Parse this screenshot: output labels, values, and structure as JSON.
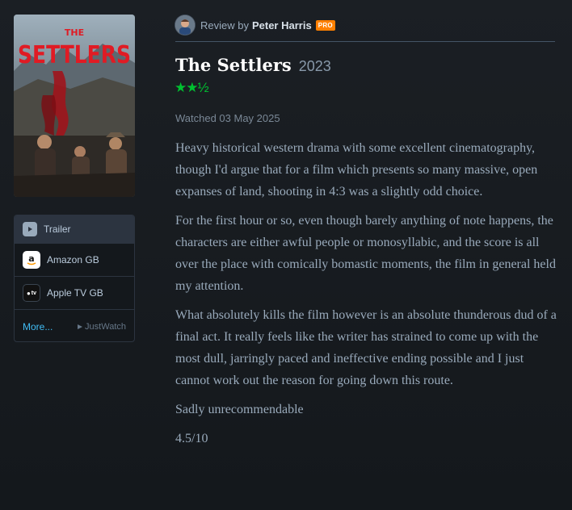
{
  "poster": {
    "title_small": "THE",
    "title_big": "SETTLERS"
  },
  "services": {
    "trailer_label": "Trailer",
    "items": [
      {
        "label": "Amazon GB",
        "icon": "amazon-icon"
      },
      {
        "label": "Apple TV GB",
        "icon": "apple-tv-icon",
        "icon_text": "tv"
      }
    ],
    "more_label": "More...",
    "justwatch_label": "JustWatch"
  },
  "review": {
    "by_prefix": "Review by",
    "author": "Peter Harris",
    "badge": "PRO",
    "film_title": "The Settlers",
    "year": "2023",
    "stars": "★★½",
    "watched": "Watched 03 May 2025",
    "paragraphs": [
      "Heavy historical western drama with some excellent cinematography, though I'd argue that for a film which presents so many massive, open expanses of land, shooting in 4:3 was a slightly odd choice.",
      "For the first hour or so, even though barely anything of note happens, the characters are either awful people or monosyllabic, and the score is all over the place with comically bomastic moments, the film in general held my attention.",
      "What absolutely kills the film however is an absolute thunderous dud of a final act. It really feels like the writer has strained to come up with the most dull, jarringly paced and ineffective ending possible and I just cannot work out the reason for going down this route.",
      "Sadly unrecommendable",
      "4.5/10"
    ]
  },
  "colors": {
    "background": "#14181c",
    "star_green": "#00c030",
    "pro_orange": "#ff8000",
    "link_blue": "#40bcf4",
    "poster_red": "#e01b24"
  }
}
